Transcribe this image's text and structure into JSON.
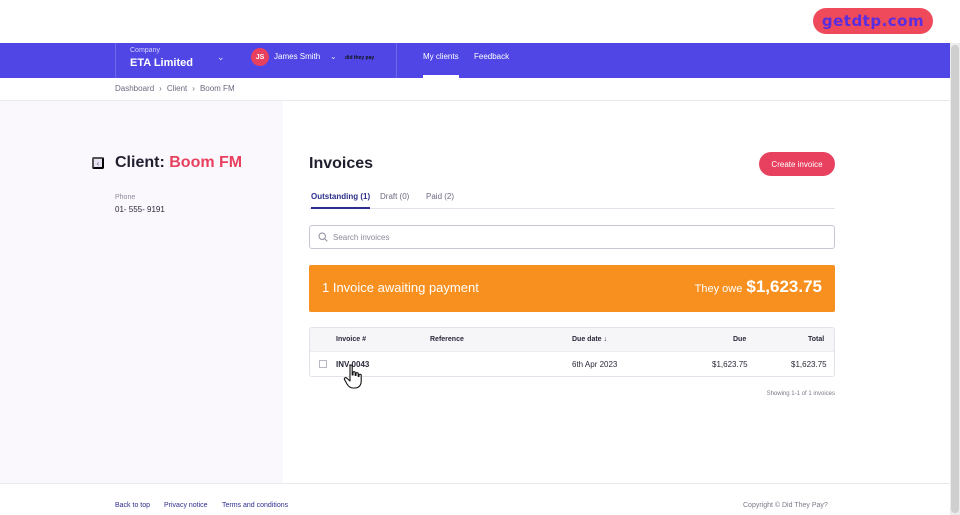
{
  "brand": {
    "badge": "getdtp.com"
  },
  "header": {
    "company_label": "Company",
    "company_name": "ETA Limited",
    "user_initials": "JS",
    "user_name": "James Smith",
    "logo_text": "did they pay",
    "nav": [
      {
        "label": "My clients",
        "active": true
      },
      {
        "label": "Feedback",
        "active": false
      }
    ]
  },
  "breadcrumb": [
    "Dashboard",
    "Client",
    "Boom FM"
  ],
  "client": {
    "title_prefix": "Client:",
    "name": "Boom FM",
    "phone_label": "Phone",
    "phone": "01- 555- 9191"
  },
  "invoices": {
    "title": "Invoices",
    "create_label": "Create invoice",
    "tabs": [
      {
        "label": "Outstanding (1)",
        "active": true
      },
      {
        "label": "Draft (0)",
        "active": false
      },
      {
        "label": "Paid (2)",
        "active": false
      }
    ],
    "search_placeholder": "Search invoices",
    "banner_text": "1 Invoice awaiting payment",
    "banner_owe_label": "They owe",
    "banner_owe_amount": "$1,623.75",
    "columns": {
      "invoice": "Invoice #",
      "reference": "Reference",
      "due_date": "Due date",
      "due": "Due",
      "total": "Total"
    },
    "rows": [
      {
        "invoice": "INV-0043",
        "reference": "",
        "due_date": "6th Apr 2023",
        "due": "$1,623.75",
        "total": "$1,623.75"
      }
    ],
    "showing": "Showing 1-1 of 1 invoices"
  },
  "footer": {
    "back_to_top": "Back to top",
    "privacy": "Privacy notice",
    "terms": "Terms and conditions",
    "copyright": "Copyright © Did They Pay?"
  },
  "colors": {
    "header": "#4f46e5",
    "accent": "#e8415f",
    "banner": "#f7901e",
    "tab_active": "#2c2e8c"
  }
}
